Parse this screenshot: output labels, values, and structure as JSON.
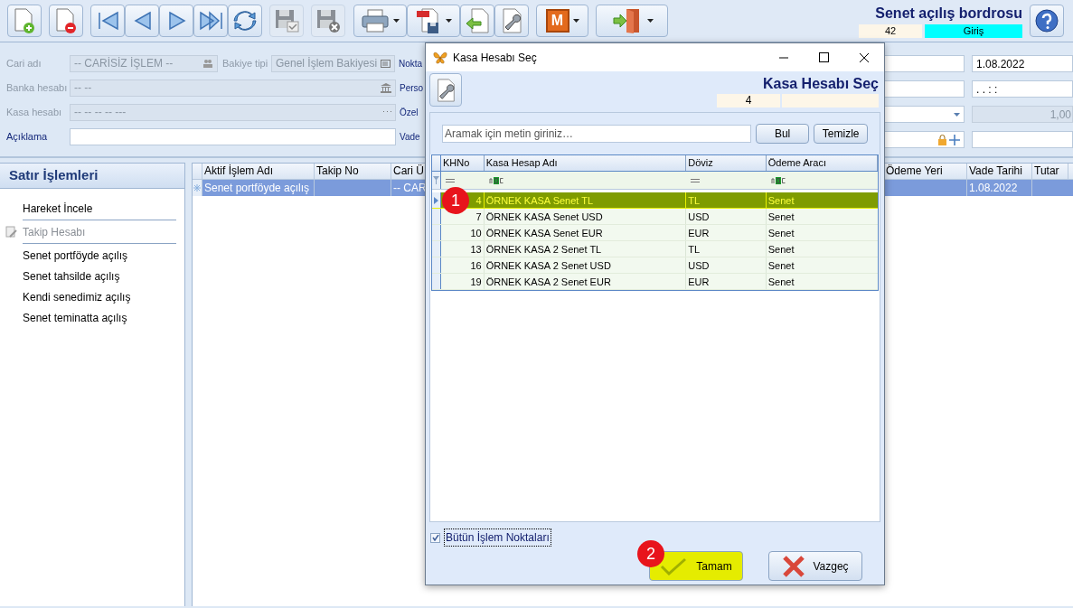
{
  "toolbar": {
    "logo_letter": "M"
  },
  "header": {
    "title": "Senet açılış bordrosu",
    "number": "42",
    "mode": "Giriş"
  },
  "form": {
    "cari_label": "Cari adı",
    "cari_value": "-- CARİSİZ İŞLEM --",
    "bakiye_label": "Bakiye tipi",
    "bakiye_value": "Genel İşlem Bakiyesi",
    "banka_label": "Banka hesabı",
    "banka_value": "-- --",
    "kasa_label": "Kasa hesabı",
    "kasa_value": "-- -- -- -- ---",
    "aciklama_label": "Açıklama",
    "right_labels": [
      "Nokta",
      "Perso",
      "Özel",
      "Vade"
    ],
    "date": "1.08.2022",
    "time": ". .     : :",
    "rate": "1,00"
  },
  "panel": {
    "title": "Satır İşlemleri",
    "items": [
      {
        "label": "Hareket İncele",
        "disabled": false,
        "separator_after": true
      },
      {
        "label": "Takip Hesabı",
        "disabled": true,
        "separator_after": true
      },
      {
        "label": "Senet portföyde açılış",
        "disabled": false,
        "separator_after": false
      },
      {
        "label": "Senet tahsilde açılış",
        "disabled": false,
        "separator_after": false
      },
      {
        "label": "Kendi senedimiz açılış",
        "disabled": false,
        "separator_after": false
      },
      {
        "label": "Senet teminatta açılış",
        "disabled": false,
        "separator_after": false
      }
    ]
  },
  "grid": {
    "columns": [
      "Aktif İşlem Adı",
      "Takip No",
      "Cari Ü",
      "Ödeme Yeri",
      "Vade Tarihi",
      "Tutar"
    ],
    "rows": [
      {
        "aktif": "Senet portföyde açılış",
        "cari": "-- CAR",
        "vade": "1.08.2022",
        "selected": true
      }
    ]
  },
  "dialog": {
    "title": "Kasa Hesabı Seç",
    "heading": "Kasa Hesabı Seç",
    "code": "4",
    "search_placeholder": "Aramak için metin giriniz…",
    "find": "Bul",
    "clear": "Temizle",
    "columns": [
      "KHNo",
      "Kasa Hesap Adı",
      "Döviz",
      "Ödeme Aracı"
    ],
    "rows": [
      {
        "no": "4",
        "name": "ÖRNEK KASA Senet TL",
        "currency": "TL",
        "method": "Senet",
        "selected": true
      },
      {
        "no": "7",
        "name": "ÖRNEK KASA Senet USD",
        "currency": "USD",
        "method": "Senet",
        "selected": false
      },
      {
        "no": "10",
        "name": "ÖRNEK KASA Senet EUR",
        "currency": "EUR",
        "method": "Senet",
        "selected": false
      },
      {
        "no": "13",
        "name": "ÖRNEK KASA 2 Senet TL",
        "currency": "TL",
        "method": "Senet",
        "selected": false
      },
      {
        "no": "16",
        "name": "ÖRNEK KASA 2 Senet USD",
        "currency": "USD",
        "method": "Senet",
        "selected": false
      },
      {
        "no": "19",
        "name": "ÖRNEK KASA 2 Senet EUR",
        "currency": "EUR",
        "method": "Senet",
        "selected": false
      }
    ],
    "checkbox": {
      "label": "Bütün İşlem Noktaları",
      "checked": true
    },
    "ok": "Tamam",
    "cancel": "Vazgeç"
  },
  "annotations": [
    "1",
    "2"
  ]
}
